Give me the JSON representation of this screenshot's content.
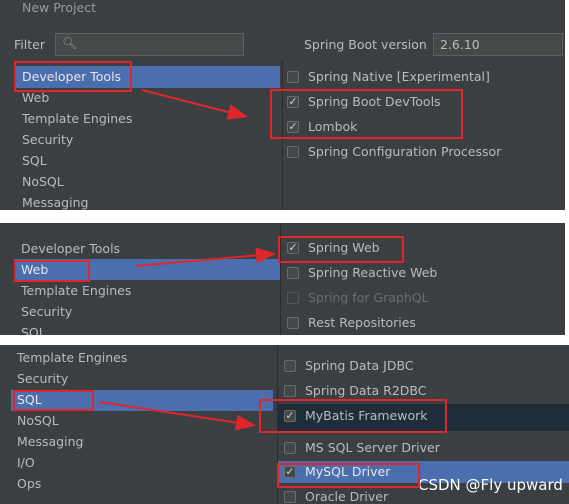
{
  "panel1": {
    "window_title": "New Project",
    "filter_label": "Filter",
    "spring_boot_version_label": "Spring Boot version",
    "spring_boot_version_value": "2.6.10",
    "categories": [
      "Developer Tools",
      "Web",
      "Template Engines",
      "Security",
      "SQL",
      "NoSQL",
      "Messaging"
    ],
    "dependencies": [
      {
        "label": "Spring Native [Experimental]",
        "checked": false
      },
      {
        "label": "Spring Boot DevTools",
        "checked": true
      },
      {
        "label": "Lombok",
        "checked": true
      },
      {
        "label": "Spring Configuration Processor",
        "checked": false
      }
    ]
  },
  "panel2": {
    "categories": [
      "Developer Tools",
      "Web",
      "Template Engines",
      "Security",
      "SQL"
    ],
    "dependencies": [
      {
        "label": "Spring Web",
        "checked": true
      },
      {
        "label": "Spring Reactive Web",
        "checked": false
      },
      {
        "label": "Spring for GraphQL",
        "checked": false,
        "disabled": true
      },
      {
        "label": "Rest Repositories",
        "checked": false
      }
    ]
  },
  "panel3": {
    "categories": [
      "Template Engines",
      "Security",
      "SQL",
      "NoSQL",
      "Messaging",
      "I/O",
      "Ops"
    ],
    "dependencies": [
      {
        "label": "Spring Data JDBC",
        "checked": false
      },
      {
        "label": "Spring Data R2DBC",
        "checked": false
      },
      {
        "label": "MyBatis Framework",
        "checked": true
      },
      {
        "label": "MS SQL Server Driver",
        "checked": false
      },
      {
        "label": "MySQL Driver",
        "checked": true
      },
      {
        "label": "Oracle Driver",
        "checked": false
      }
    ]
  },
  "watermark": "CSDN @Fly upward",
  "colors": {
    "panel_bg": "#3c3f41",
    "selection": "#4b6eaf",
    "annotation": "#e0262a",
    "text": "#bbbbbb"
  }
}
